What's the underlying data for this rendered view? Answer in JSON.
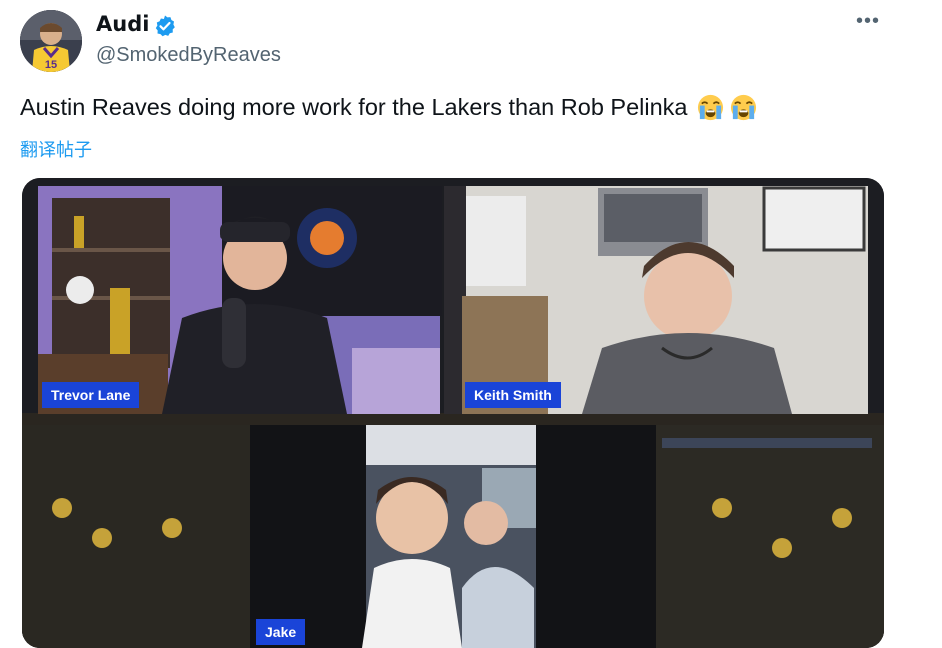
{
  "tweet": {
    "author_name": "Audi",
    "author_handle": "@SmokedByReaves",
    "text": "Austin Reaves doing more work for the Lakers than Rob Pelinka",
    "emojis": [
      "loudly-crying-face",
      "loudly-crying-face"
    ],
    "translate_label": "翻译帖子",
    "more_label": "•••",
    "avatar_jersey_number": "15"
  },
  "media": {
    "participants": [
      {
        "name": "Trevor Lane"
      },
      {
        "name": "Keith Smith"
      },
      {
        "name": "Jake"
      }
    ]
  },
  "colors": {
    "verified_blue": "#1d9bf0",
    "translate_link": "#1d9bf0",
    "nameplate_blue": "#1a44d8"
  }
}
